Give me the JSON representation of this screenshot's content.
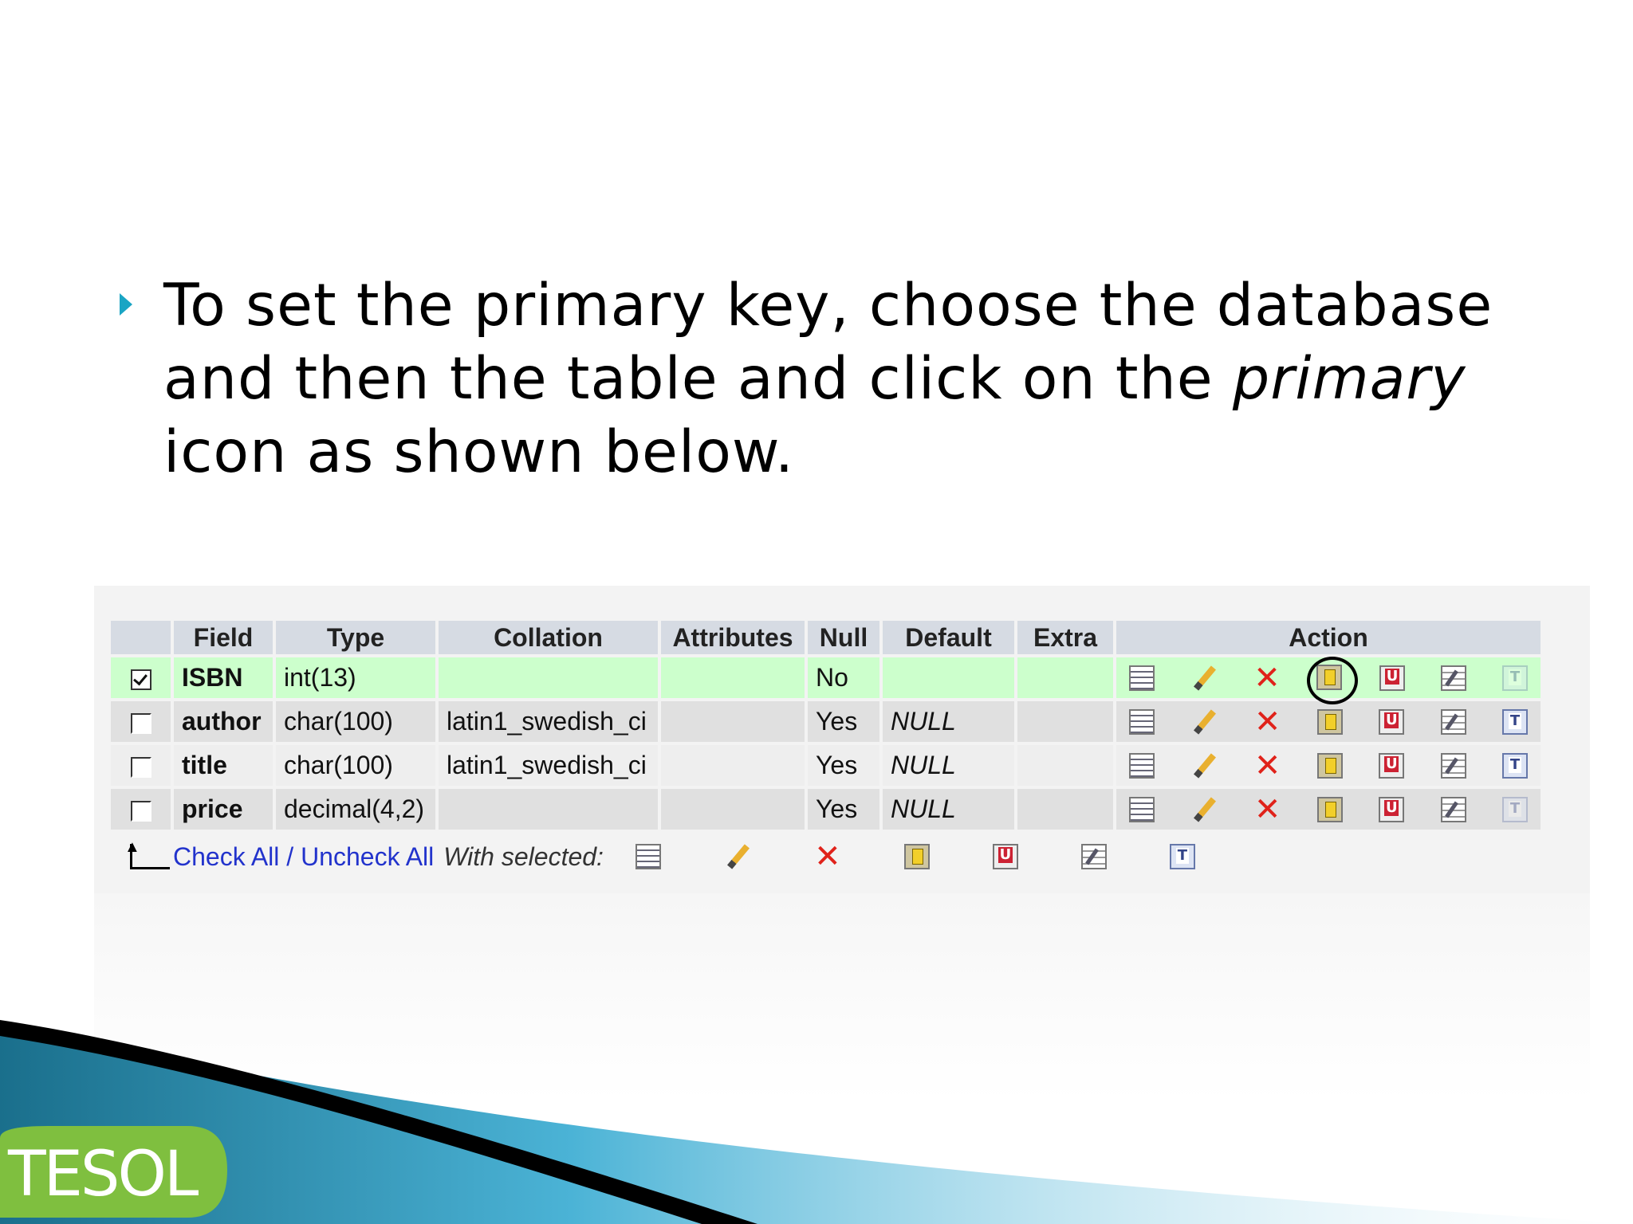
{
  "slide": {
    "bullet_line1": "To set the primary key, choose the database",
    "bullet_line2a": "and then the table and click on the ",
    "bullet_line2_em": "primary",
    "bullet_line3": "icon as shown below.",
    "accent_color": "#1aa5c4"
  },
  "table": {
    "headers": {
      "field": "Field",
      "type": "Type",
      "collation": "Collation",
      "attributes": "Attributes",
      "null": "Null",
      "default": "Default",
      "extra": "Extra",
      "action": "Action"
    },
    "rows": [
      {
        "checked": true,
        "field": "ISBN",
        "type": "int(13)",
        "collation": "",
        "attributes": "",
        "null": "No",
        "default": "",
        "extra": ""
      },
      {
        "checked": false,
        "field": "author",
        "type": "char(100)",
        "collation": "latin1_swedish_ci",
        "attributes": "",
        "null": "Yes",
        "default": "NULL",
        "extra": ""
      },
      {
        "checked": false,
        "field": "title",
        "type": "char(100)",
        "collation": "latin1_swedish_ci",
        "attributes": "",
        "null": "Yes",
        "default": "NULL",
        "extra": ""
      },
      {
        "checked": false,
        "field": "price",
        "type": "decimal(4,2)",
        "collation": "",
        "attributes": "",
        "null": "Yes",
        "default": "NULL",
        "extra": ""
      }
    ],
    "action_icons": [
      "browse-icon",
      "edit-icon",
      "drop-icon",
      "primary-icon",
      "unique-icon",
      "index-icon",
      "fulltext-icon"
    ],
    "footer": {
      "check_all": "Check All",
      "separator": " / ",
      "uncheck_all": "Uncheck All",
      "with_selected": "With selected:"
    },
    "row_colors": {
      "selected": "#ccffcc",
      "odd": "#e0e0e0",
      "even": "#eeeeee"
    }
  },
  "logo": {
    "text": "TESOL",
    "color": "#7fbf3f"
  }
}
